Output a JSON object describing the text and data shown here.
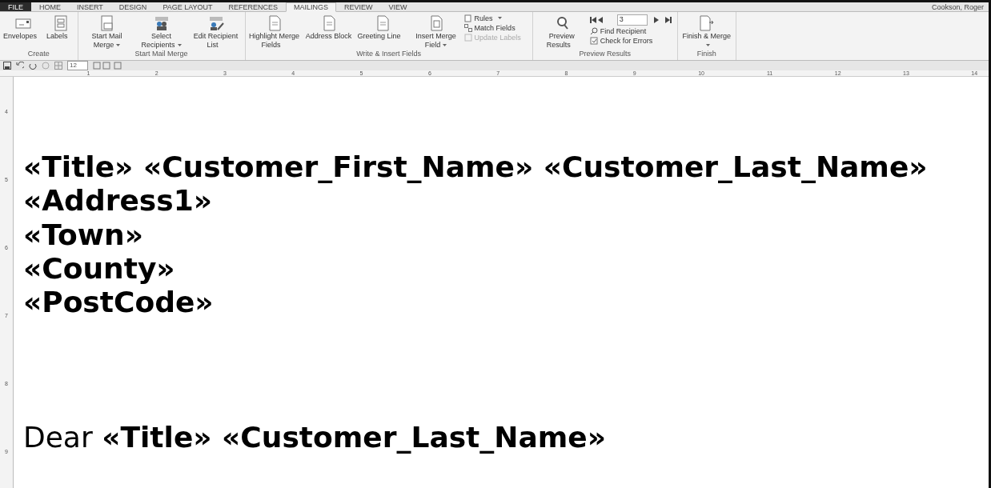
{
  "tabs": [
    {
      "label": "FILE",
      "selected": false,
      "kind": "file"
    },
    {
      "label": "HOME",
      "selected": false,
      "kind": "tab"
    },
    {
      "label": "INSERT",
      "selected": false,
      "kind": "tab"
    },
    {
      "label": "DESIGN",
      "selected": false,
      "kind": "tab"
    },
    {
      "label": "PAGE LAYOUT",
      "selected": false,
      "kind": "tab"
    },
    {
      "label": "REFERENCES",
      "selected": false,
      "kind": "tab"
    },
    {
      "label": "MAILINGS",
      "selected": true,
      "kind": "tab"
    },
    {
      "label": "REVIEW",
      "selected": false,
      "kind": "tab"
    },
    {
      "label": "VIEW",
      "selected": false,
      "kind": "tab"
    }
  ],
  "user": "Cookson, Roger",
  "ribbon_groups": [
    {
      "label": "Create",
      "items": [
        {
          "kind": "large",
          "label": "Envelopes",
          "dropdown": false
        },
        {
          "kind": "large",
          "label": "Labels",
          "dropdown": false
        }
      ]
    },
    {
      "label": "Start Mail Merge",
      "items": [
        {
          "kind": "large",
          "label": "Start Mail Merge",
          "dropdown": true
        },
        {
          "kind": "large",
          "label": "Select Recipients",
          "dropdown": true
        },
        {
          "kind": "large",
          "label": "Edit Recipient List",
          "dropdown": false
        }
      ]
    },
    {
      "label": "Write & Insert Fields",
      "items": [
        {
          "kind": "large",
          "label": "Highlight Merge Fields",
          "dropdown": false
        },
        {
          "kind": "large",
          "label": "Address Block",
          "dropdown": false
        },
        {
          "kind": "large",
          "label": "Greeting Line",
          "dropdown": false
        },
        {
          "kind": "large",
          "label": "Insert Merge Field",
          "dropdown": true
        },
        {
          "kind": "stack",
          "items": [
            {
              "label": "Rules",
              "dropdown": true,
              "disabled": false
            },
            {
              "label": "Match Fields",
              "dropdown": false,
              "disabled": false
            },
            {
              "label": "Update Labels",
              "dropdown": false,
              "disabled": true
            }
          ]
        }
      ]
    },
    {
      "label": "Preview Results",
      "items": [
        {
          "kind": "large",
          "label": "Preview Results",
          "dropdown": false
        },
        {
          "kind": "nav",
          "value": "3",
          "items": [
            {
              "label": "Find Recipient"
            },
            {
              "label": "Check for Errors"
            }
          ]
        }
      ]
    },
    {
      "label": "Finish",
      "items": [
        {
          "kind": "large",
          "label": "Finish & Merge",
          "dropdown": true
        }
      ]
    }
  ],
  "quick_access": {
    "font_size": "12"
  },
  "ruler_numbers": [
    "1",
    "2",
    "3",
    "4",
    "5",
    "6",
    "7",
    "8",
    "9",
    "10",
    "11",
    "12",
    "13",
    "14"
  ],
  "vertical_ruler_numbers": [
    "4",
    "5",
    "6",
    "7",
    "8",
    "9"
  ],
  "document": [
    {
      "kind": "field",
      "text": "«Title» «Customer_First_Name» «Customer_Last_Name»"
    },
    {
      "kind": "field",
      "text": "«Address1»"
    },
    {
      "kind": "field",
      "text": "«Town»"
    },
    {
      "kind": "field",
      "text": "«County»"
    },
    {
      "kind": "field",
      "text": "«PostCode»"
    },
    {
      "kind": "blank"
    },
    {
      "kind": "blank"
    },
    {
      "kind": "blank"
    },
    {
      "kind": "mixed",
      "text": "Dear **«Title» «Customer_Last_Name»**"
    }
  ]
}
